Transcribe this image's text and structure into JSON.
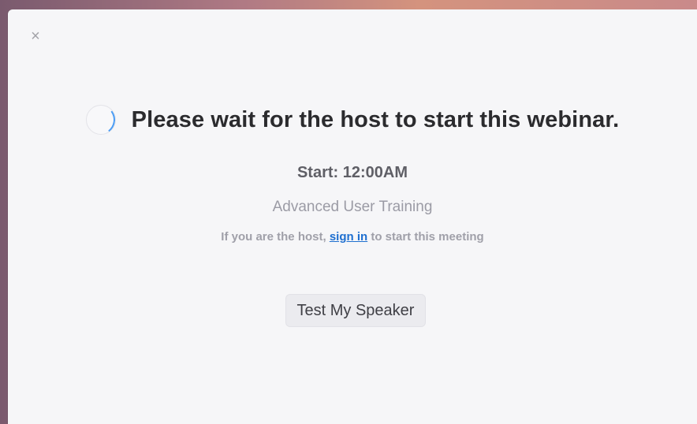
{
  "window": {
    "close_symbol": "×",
    "title": "Please wait for the host to start this webinar.",
    "start_label": "Start: 12:00AM",
    "topic": "Advanced User Training",
    "host_prefix": "If you are the host, ",
    "sign_in_link": "sign in",
    "host_suffix": " to start this meeting",
    "test_speaker_button": "Test My Speaker"
  },
  "icons": {
    "close": "close-icon",
    "spinner": "loading-spinner-icon"
  },
  "colors": {
    "link": "#1e6fd0",
    "spinner_accent": "#4a9cf5",
    "background": "#f6f6f8"
  }
}
